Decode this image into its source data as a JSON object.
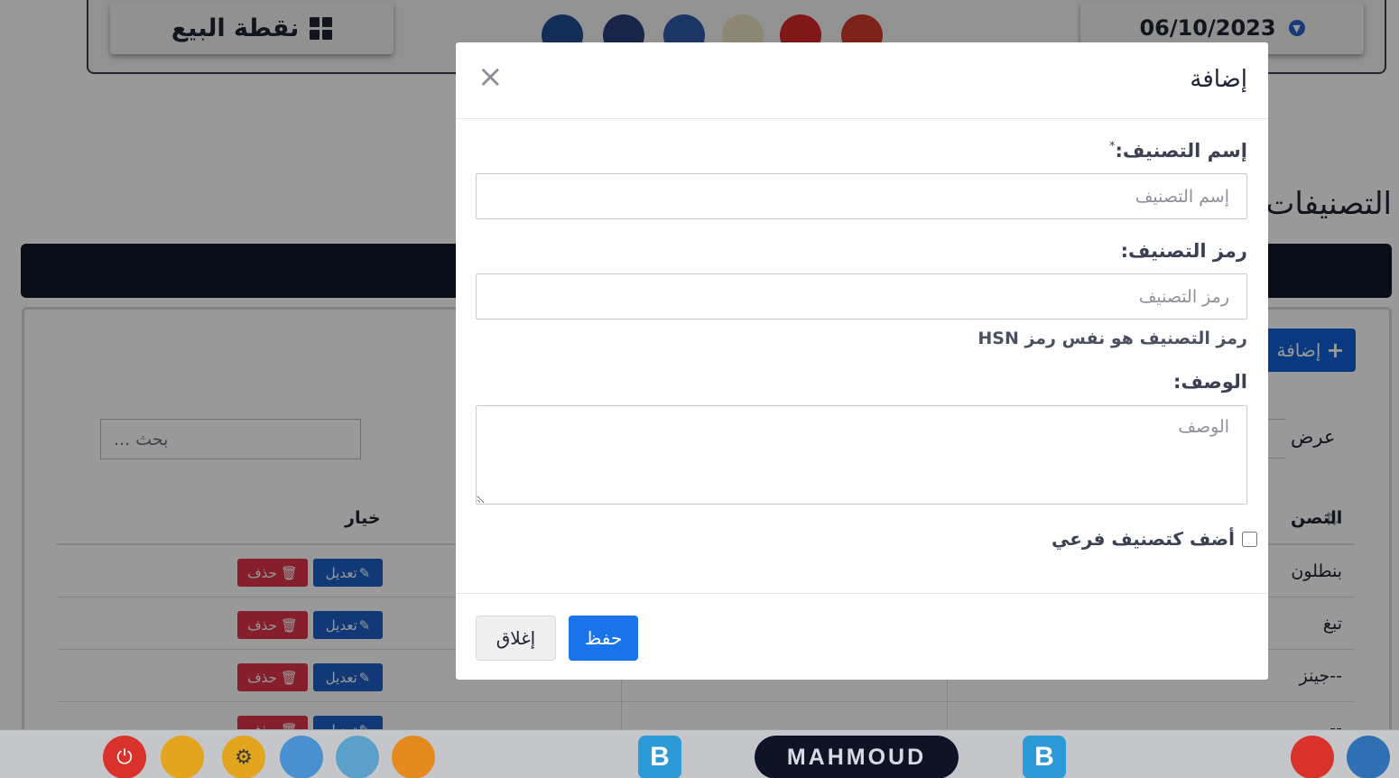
{
  "header": {
    "pos_label": "نقطة البيع",
    "date": "06/10/2023"
  },
  "page": {
    "title": "التصنيفات",
    "add_button": "إضافة",
    "show_label": "عرض",
    "search_placeholder": "بحث ...",
    "table": {
      "col_name": "التصن",
      "col_options": "خيار",
      "rows": [
        {
          "name": "بنطلون"
        },
        {
          "name": "تبغ"
        },
        {
          "name": "--جينز"
        },
        {
          "name": "--"
        }
      ],
      "edit_label": "تعديل",
      "delete_label": "حذف"
    }
  },
  "modal": {
    "title": "إضافة",
    "close_glyph": "×",
    "name_label": "إسم التصنيف:",
    "name_required_mark": "*",
    "name_placeholder": "إسم التصنيف",
    "code_label": "رمز التصنيف:",
    "code_placeholder": "رمز التصنيف",
    "code_help": "رمز التصنيف هو نفس رمز HSN",
    "desc_label": "الوصف:",
    "desc_placeholder": "الوصف",
    "subcategory_label": "أضف كتصنيف فرعي",
    "subcategory_checked": false,
    "save_button": "حفظ",
    "close_button": "إغلاق"
  },
  "taskbar": {
    "user_name": "MAHMOUD",
    "b_label": "B"
  },
  "colors": {
    "primary": "#1a73e8",
    "danger": "#e0344a",
    "dark_strip": "#0f1626"
  }
}
